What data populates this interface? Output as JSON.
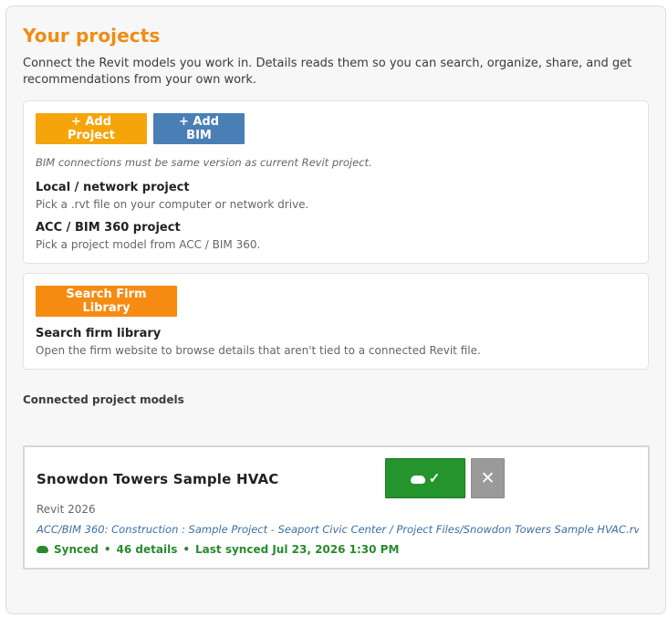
{
  "page": {
    "title": "Your projects",
    "intro": "Connect the Revit models you work in. Details reads them so you can search, organize, share, and get recommendations from your own work."
  },
  "add_card": {
    "add_project_label": "+ Add Project",
    "add_bim_label": "+ Add BIM",
    "note": "BIM connections must be same version as current Revit project.",
    "options": [
      {
        "title": "Local / network project",
        "description": "Pick a .rvt file on your computer or network drive."
      },
      {
        "title": "ACC / BIM 360 project",
        "description": "Pick a project model from ACC / BIM 360."
      }
    ]
  },
  "firm_card": {
    "button_label": "Search Firm Library",
    "title": "Search firm library",
    "description": "Open the firm website to browse details that aren't tied to a connected Revit file."
  },
  "connected": {
    "section_label": "Connected project models",
    "models": [
      {
        "name": "Snowdon Towers Sample HVAC",
        "sync_check": "✓",
        "remove_glyph": "✕",
        "version": "Revit 2026",
        "path": "ACC/BIM 360: Construction : Sample Project - Seaport Civic Center / Project Files/Snowdon Towers Sample HVAC.rvt",
        "status": "Synced",
        "details": "46 details",
        "last_synced": "Last synced Jul 23, 2026 1:30 PM",
        "separator": "•"
      }
    ]
  },
  "colors": {
    "accent_orange": "#f08c14",
    "add_bim_blue": "#4a7fb5",
    "sync_green": "#24942d",
    "remove_gray": "#9a9a9a"
  },
  "icons": {
    "sync": "cloud-icon",
    "check": "check-icon",
    "remove": "close-icon"
  }
}
